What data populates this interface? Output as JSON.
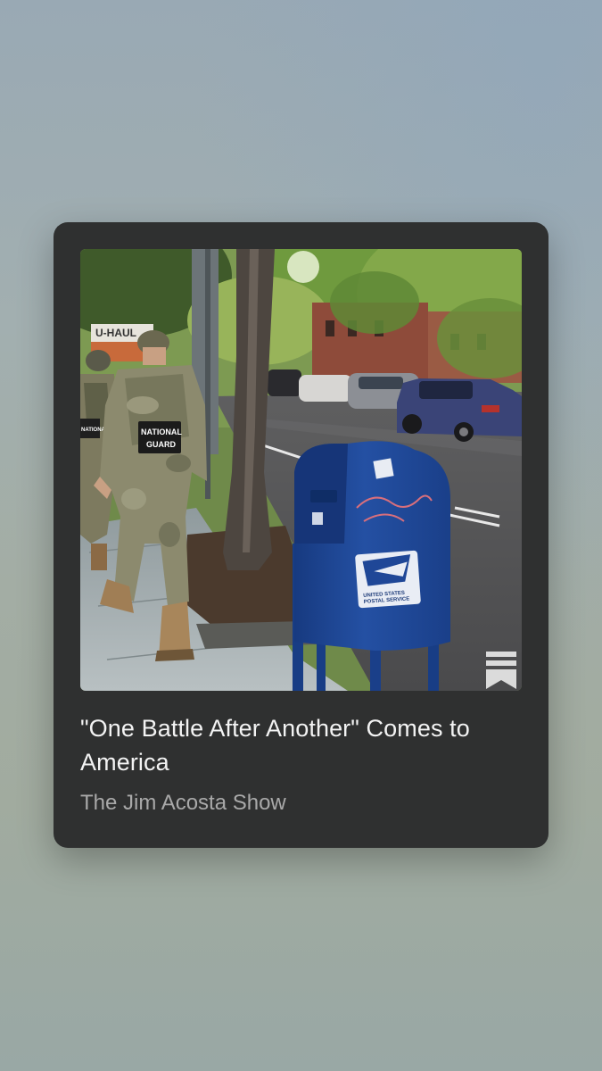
{
  "post": {
    "title": "\"One Battle After Another\" Comes to America",
    "source": "The Jim Acosta Show",
    "image_alt": "National Guard soldiers walking past a USPS mailbox on a tree-lined street",
    "image_text": {
      "truck_sign": "U-HAUL",
      "patch_line1": "NATIONAL",
      "patch_line2": "GUARD",
      "side_patch": "NATIONAL",
      "usps_line1": "UNITED STATES",
      "usps_line2": "POSTAL SERVICE"
    }
  },
  "icons": {
    "bookmark": "bookmark-icon"
  },
  "colors": {
    "card_bg": "#2f3030",
    "title_text": "#f3f3f3",
    "source_text": "#a9a9a9",
    "mailbox_blue": "#1f4797"
  }
}
